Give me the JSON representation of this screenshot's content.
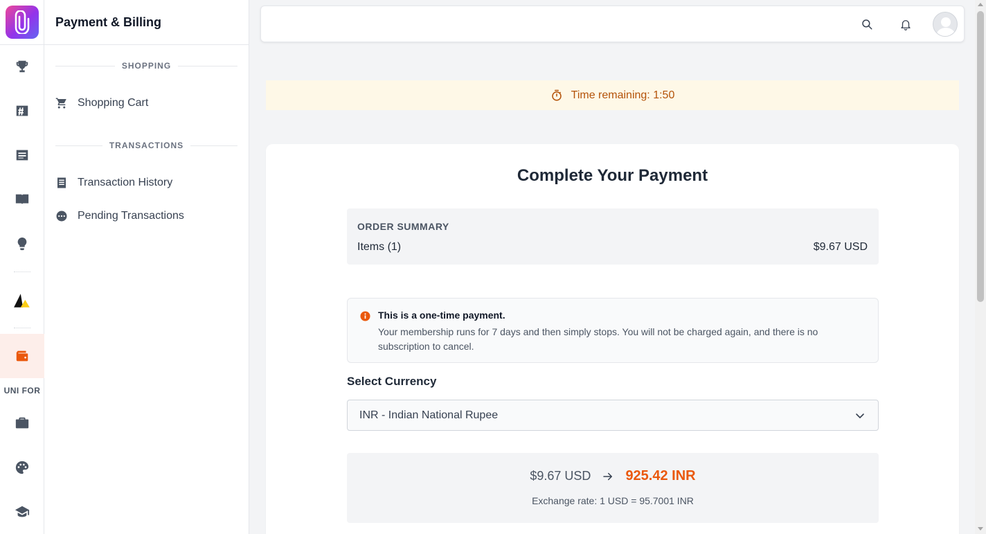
{
  "sidebar": {
    "title": "Payment & Billing",
    "sections": [
      {
        "heading": "SHOPPING",
        "items": [
          {
            "label": "Shopping Cart",
            "icon": "cart-icon"
          }
        ]
      },
      {
        "heading": "TRANSACTIONS",
        "items": [
          {
            "label": "Transaction History",
            "icon": "receipt-icon"
          },
          {
            "label": "Pending Transactions",
            "icon": "pending-icon"
          }
        ]
      }
    ]
  },
  "rail": {
    "group_label": "UNI FOR",
    "icons": [
      "trophy-icon",
      "tag-hash-icon",
      "news-icon",
      "book-icon",
      "lightbulb-icon",
      "triangle-logo-icon",
      "wallet-icon",
      "briefcase-icon",
      "palette-icon",
      "graduation-cap-icon"
    ],
    "active": "wallet-icon"
  },
  "topbar": {
    "icons": [
      "search-icon",
      "bell-icon",
      "avatar"
    ]
  },
  "timer": {
    "text": "Time remaining: 1:50"
  },
  "payment": {
    "title": "Complete Your Payment",
    "summary": {
      "label": "ORDER SUMMARY",
      "items": "Items (1)",
      "total": "$9.67 USD"
    },
    "notice": {
      "heading": "This is a one-time payment.",
      "body": "Your membership runs for 7 days and then simply stops. You will not be charged again, and there is no subscription to cancel."
    },
    "currency": {
      "label": "Select Currency",
      "selected": "INR - Indian National Rupee"
    },
    "conversion": {
      "from": "$9.67 USD",
      "to": "925.42 INR",
      "rate": "Exchange rate: 1 USD = 95.7001 INR"
    }
  },
  "colors": {
    "accent": "#ea580c",
    "timer_bg": "#fef8e7",
    "timer_text": "#b45309"
  }
}
